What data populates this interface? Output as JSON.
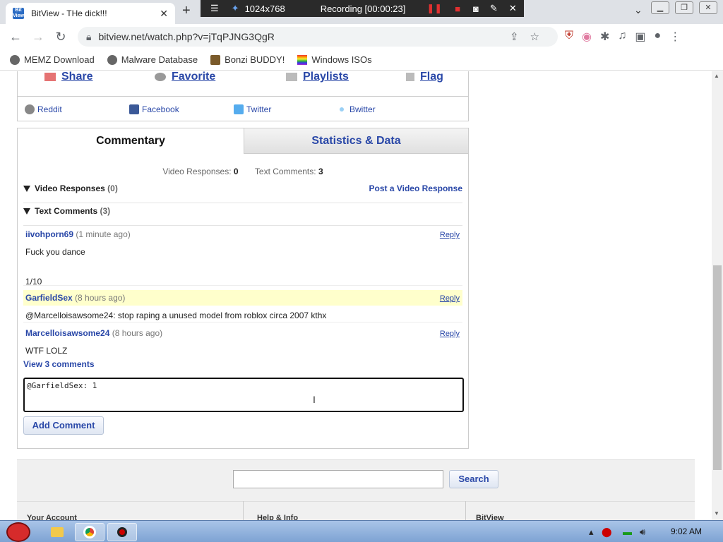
{
  "browser": {
    "tab_title": "BitView - THe dick!!!",
    "tab_favicon": "Bit View",
    "url": "bitview.net/watch.php?v=jTqPJNG3QgR",
    "recorder": {
      "resolution": "1024x768",
      "status": "Recording [00:00:23]"
    },
    "bookmarks": [
      {
        "label": "MEMZ Download"
      },
      {
        "label": "Malware Database"
      },
      {
        "label": "Bonzi BUDDY!"
      },
      {
        "label": "Windows ISOs"
      }
    ]
  },
  "share": {
    "actions": [
      {
        "label": "Share"
      },
      {
        "label": "Favorite"
      },
      {
        "label": "Playlists"
      },
      {
        "label": "Flag"
      }
    ],
    "social": [
      {
        "label": "Reddit",
        "color": "#888888"
      },
      {
        "label": "Facebook",
        "color": "#3b5998"
      },
      {
        "label": "Twitter",
        "color": "#55acee"
      },
      {
        "label": "Bwitter",
        "color": "#9ad0f5"
      }
    ]
  },
  "tabs": {
    "commentary": "Commentary",
    "stats": "Statistics & Data"
  },
  "counts": {
    "video_responses_label": "Video Responses:",
    "video_responses_value": "0",
    "text_comments_label": "Text Comments:",
    "text_comments_value": "3"
  },
  "sections": {
    "video_responses": {
      "label": "Video Responses",
      "count": "(0)",
      "action": "Post a Video Response"
    },
    "text_comments": {
      "label": "Text Comments",
      "count": "(3)"
    }
  },
  "comments": [
    {
      "user": "iivohporn69",
      "time": "(1 minute ago)",
      "body_line1": "Fuck you dance",
      "body_line2": "1/10",
      "reply": "Reply"
    },
    {
      "user": "GarfieldSex",
      "time": "(8 hours ago)",
      "body_line1": "@Marcelloisawsome24: stop raping a unused model from roblox circa 2007 kthx",
      "reply": "Reply"
    },
    {
      "user": "Marcelloisawsome24",
      "time": "(8 hours ago)",
      "body_line1": "WTF LOLZ",
      "reply": "Reply"
    }
  ],
  "view_more": "View 3 comments",
  "comment_box_value": "@GarfieldSex: 1",
  "add_comment": "Add Comment",
  "footer": {
    "search_button": "Search",
    "columns": [
      "Your Account",
      "Help & Info",
      "BitView"
    ]
  },
  "taskbar": {
    "clock": "9:02 AM"
  }
}
